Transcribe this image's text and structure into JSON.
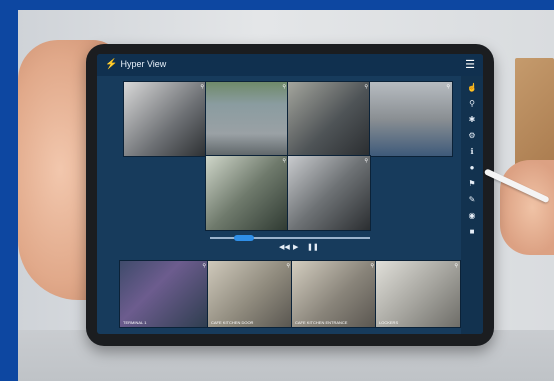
{
  "app": {
    "title": "Hyper View"
  },
  "icons": {
    "app_logo": "lightning-bolt-icon",
    "menu": "hamburger-menu-icon",
    "sidebar": [
      "hand-pointer-icon",
      "search-icon",
      "settings-icon",
      "gear-icon",
      "info-icon",
      "user-icon",
      "flag-icon",
      "pen-icon",
      "camera-icon",
      "lock-icon"
    ],
    "controls": [
      "previous-icon",
      "play-icon",
      "pause-icon"
    ]
  },
  "playback": {
    "progress_fraction": 0.15
  },
  "cameras_top": [
    {
      "id": "cam-1",
      "label": "",
      "color": "#6b6e72"
    },
    {
      "id": "cam-2",
      "label": "",
      "color": "#7c8a8f"
    },
    {
      "id": "cam-3",
      "label": "",
      "color": "#4f5457"
    },
    {
      "id": "cam-4",
      "label": "",
      "color": "#8a8f93"
    },
    {
      "id": "cam-5",
      "label": "",
      "color": "#6f7a6c"
    },
    {
      "id": "cam-6",
      "label": "",
      "color": "#6e7275"
    }
  ],
  "cameras_bottom": [
    {
      "id": "cam-7",
      "label": "TERMINAL 1",
      "color": "#3f4b6b"
    },
    {
      "id": "cam-8",
      "label": "CAFE KITCHEN DOOR",
      "color": "#8f8a7d"
    },
    {
      "id": "cam-9",
      "label": "CAFE KITCHEN ENTRANCE",
      "color": "#89847a"
    },
    {
      "id": "cam-10",
      "label": "LOCKERS",
      "color": "#a3a29c"
    }
  ]
}
